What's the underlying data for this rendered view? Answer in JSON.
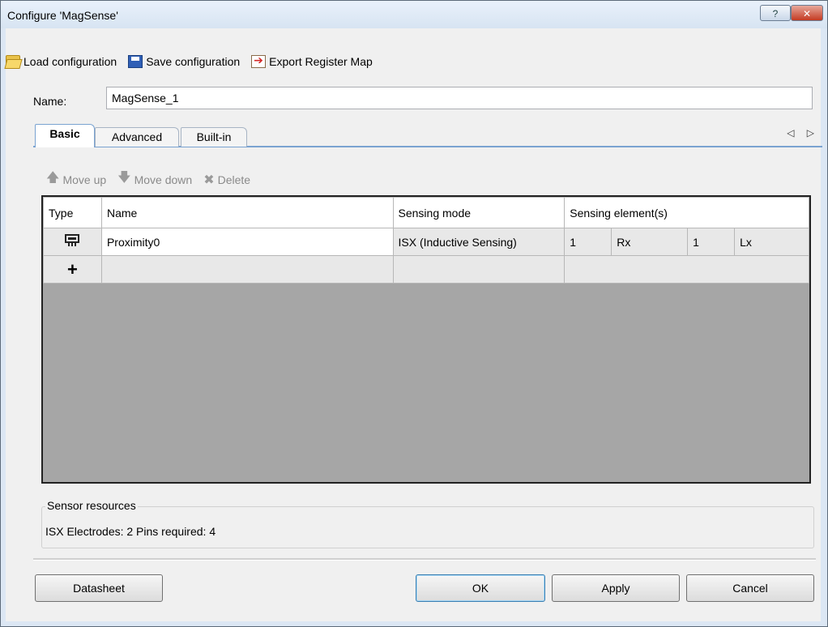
{
  "window": {
    "title": "Configure 'MagSense'",
    "help_label": "?",
    "close_label": "✕"
  },
  "toolbar": {
    "load_label": "Load configuration",
    "save_label": "Save configuration",
    "export_label": "Export Register Map"
  },
  "name_field": {
    "label": "Name:",
    "value": "MagSense_1"
  },
  "tabs": {
    "items": [
      "Basic",
      "Advanced",
      "Built-in"
    ],
    "active": "Basic",
    "arrows": "◁ ▷"
  },
  "actions": {
    "move_up": "Move up",
    "move_down": "Move down",
    "delete": "Delete"
  },
  "grid": {
    "headers": [
      "Type",
      "Name",
      "Sensing mode",
      "Sensing element(s)"
    ],
    "rows": [
      {
        "name": "Proximity0",
        "mode": "ISX (Inductive Sensing)",
        "e1": "1",
        "e2": "Rx",
        "e3": "1",
        "e4": "Lx"
      }
    ],
    "add_row_label": "+"
  },
  "resources": {
    "legend": "Sensor resources",
    "summary": "ISX Electrodes:  2  Pins required:  4"
  },
  "buttons": {
    "datasheet": "Datasheet",
    "ok": "OK",
    "apply": "Apply",
    "cancel": "Cancel"
  }
}
